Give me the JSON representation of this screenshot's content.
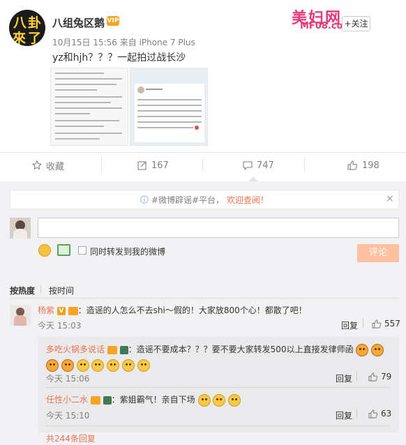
{
  "post": {
    "author": "八组兔区鹅",
    "avatar_text": [
      "八",
      "卦",
      "來",
      "了"
    ],
    "vip_badge": "VIP",
    "time": "10月15日 15:56",
    "source": "来自 iPhone 7 Plus",
    "follow_label": "+关注",
    "text": "yz和hjh？？？一起拍过战长沙",
    "watermark": {
      "title": "美妇网",
      "url": "MF08.com"
    }
  },
  "actions": {
    "favorite": "收藏",
    "repost": "167",
    "comment": "747",
    "like": "198"
  },
  "notice": {
    "hashtag": "#微博辟谣#平台，",
    "link": "欢迎查阅！",
    "close": "×"
  },
  "composer": {
    "placeholder": "",
    "sync_label": "同时转发到我的微博",
    "submit_label": "评论"
  },
  "sort": {
    "hot": "按热度",
    "time": "按时间"
  },
  "comments": [
    {
      "name": "杨紫",
      "text": "：造谣的人怎么不去shi～假的！大家放800个心！都散了吧！",
      "time": "今天 15:03",
      "reply_label": "回复",
      "likes": "557"
    }
  ],
  "replies": [
    {
      "name": "多吃火锅多说话",
      "text": "：造谣不要成本？？？要不要大家转发500以上直接发律师函",
      "time": "今天 15:06",
      "reply_label": "回复",
      "likes": "79"
    },
    {
      "name": "任性小二水",
      "text": "：紫姐霸气！亲自下场",
      "time": "今天 15:10",
      "reply_label": "回复",
      "likes": "63"
    }
  ],
  "total_replies": "共244条回复",
  "colors": {
    "accent": "#eb7350",
    "submit_bg": "#ffc09f",
    "panel_bg": "#f2f2f5"
  }
}
